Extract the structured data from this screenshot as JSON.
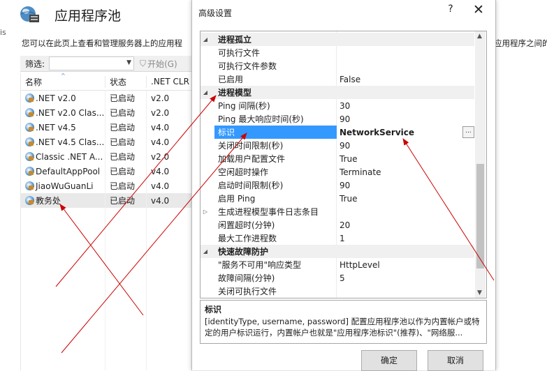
{
  "background_window": {
    "left_edge_text": "is",
    "title": "应用程序池",
    "description": "您可以在此页上查看和管理服务器上的应用程",
    "description_right": "应用程序之间的",
    "filter": {
      "label": "筛选:",
      "start_label": "开始(G)"
    },
    "columns": [
      "名称",
      "状态",
      ".NET CLR"
    ],
    "rows": [
      {
        "name": ".NET v2.0",
        "status": "已启动",
        "clr": "v2.0"
      },
      {
        "name": ".NET v2.0 Clas...",
        "status": "已启动",
        "clr": "v2.0"
      },
      {
        "name": ".NET v4.5",
        "status": "已启动",
        "clr": "v4.0"
      },
      {
        "name": ".NET v4.5 Clas...",
        "status": "已启动",
        "clr": "v4.0"
      },
      {
        "name": "Classic .NET A...",
        "status": "已启动",
        "clr": "v2.0"
      },
      {
        "name": "DefaultAppPool",
        "status": "已启动",
        "clr": "v4.0"
      },
      {
        "name": "JiaoWuGuanLi",
        "status": "已启动",
        "clr": "v4.0"
      },
      {
        "name": "教务处",
        "status": "已启动",
        "clr": "v4.0"
      }
    ]
  },
  "dialog": {
    "title": "高级设置",
    "help_label": "?",
    "close_label": "✕",
    "properties": [
      {
        "type": "category",
        "name": "进程孤立",
        "expanded": true
      },
      {
        "type": "item",
        "name": "可执行文件",
        "value": ""
      },
      {
        "type": "item",
        "name": "可执行文件参数",
        "value": ""
      },
      {
        "type": "item",
        "name": "已启用",
        "value": "False"
      },
      {
        "type": "category",
        "name": "进程模型",
        "expanded": true
      },
      {
        "type": "item",
        "name": "Ping 间隔(秒)",
        "value": "30"
      },
      {
        "type": "item",
        "name": "Ping 最大响应时间(秒)",
        "value": "90"
      },
      {
        "type": "item",
        "name": "标识",
        "value": "NetworkService",
        "selected": true
      },
      {
        "type": "item",
        "name": "关闭时间限制(秒)",
        "value": "90"
      },
      {
        "type": "item",
        "name": "加载用户配置文件",
        "value": "True"
      },
      {
        "type": "item",
        "name": "空闲超时操作",
        "value": "Terminate"
      },
      {
        "type": "item",
        "name": "启动时间限制(秒)",
        "value": "90"
      },
      {
        "type": "item",
        "name": "启用 Ping",
        "value": "True"
      },
      {
        "type": "subcategory",
        "name": "生成进程模型事件日志条目",
        "expanded": false
      },
      {
        "type": "item",
        "name": "闲置超时(分钟)",
        "value": "20"
      },
      {
        "type": "item",
        "name": "最大工作进程数",
        "value": "1"
      },
      {
        "type": "category",
        "name": "快速故障防护",
        "expanded": true
      },
      {
        "type": "item",
        "name": "\"服务不可用\"响应类型",
        "value": "HttpLevel"
      },
      {
        "type": "item",
        "name": "故障间隔(分钟)",
        "value": "5"
      },
      {
        "type": "item",
        "name": "关闭可执行文件",
        "value": ""
      }
    ],
    "ellipsis_label": "...",
    "description": {
      "title": "标识",
      "text": "[identityType, username, password] 配置应用程序池以作为内置帐户或特定的用户标识运行，内置帐户也就是\"应用程序池标识\"(推荐)、\"网络服..."
    },
    "ok_label": "确定",
    "cancel_label": "取消"
  },
  "colors": {
    "selection": "#3399ff",
    "annotation_arrow": "#cc0000"
  }
}
